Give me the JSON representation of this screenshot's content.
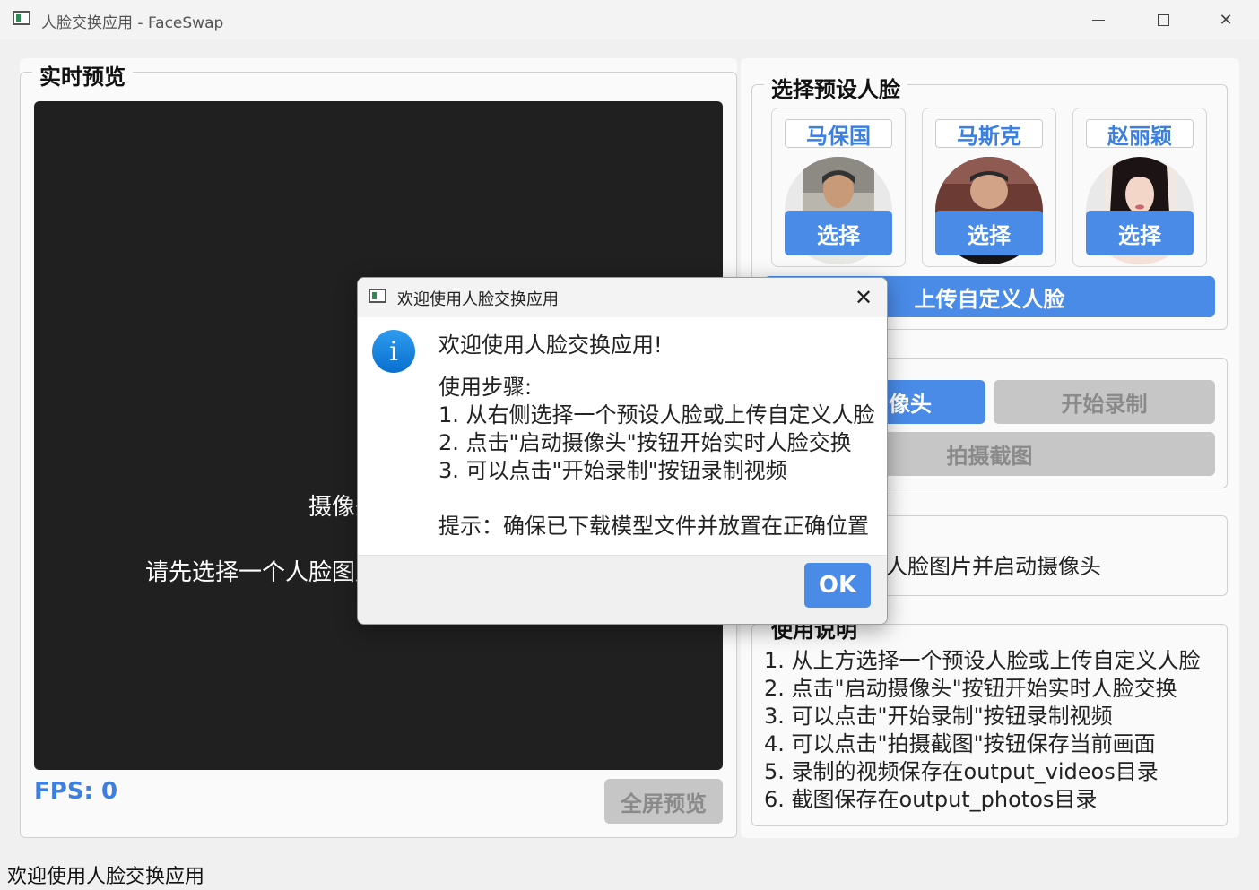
{
  "window": {
    "title": "人脸交换应用 - FaceSwap"
  },
  "left": {
    "group_title": "实时预览",
    "preview_line1": "摄像头未启动",
    "preview_line2": "请先选择一个人脸图片，然后点击启动摄像头",
    "fps": "FPS: 0",
    "fullscreen_label": "全屏预览"
  },
  "faces": {
    "group_title": "选择预设人脸",
    "items": [
      {
        "name": "马保国",
        "select_label": "选择"
      },
      {
        "name": "马斯克",
        "select_label": "选择"
      },
      {
        "name": "赵丽颖",
        "select_label": "选择"
      }
    ],
    "upload_label": "上传自定义人脸"
  },
  "controls": {
    "start_camera_label": "启动摄像头",
    "start_camera_visible": "像头",
    "record_label": "开始录制",
    "snapshot_label": "拍摄截图"
  },
  "status": {
    "visible_text": "人脸图片并启动摄像头"
  },
  "instructions": {
    "title": "使用说明",
    "items": [
      "1. 从上方选择一个预设人脸或上传自定义人脸",
      "2. 点击\"启动摄像头\"按钮开始实时人脸交换",
      "3. 可以点击\"开始录制\"按钮录制视频",
      "4. 可以点击\"拍摄截图\"按钮保存当前画面",
      "5. 录制的视频保存在output_videos目录",
      "6. 截图保存在output_photos目录"
    ]
  },
  "statusbar": {
    "text": "欢迎使用人脸交换应用"
  },
  "dialog": {
    "title": "欢迎使用人脸交换应用",
    "heading": "欢迎使用人脸交换应用!",
    "steps_title": "使用步骤:",
    "steps": [
      "1. 从右侧选择一个预设人脸或上传自定义人脸",
      "2. 点击\"启动摄像头\"按钮开始实时人脸交换",
      "3. 可以点击\"开始录制\"按钮录制视频"
    ],
    "tip": "提示：确保已下载模型文件并放置在正确位置",
    "ok_label": "OK"
  },
  "colors": {
    "accent": "#4a8be8",
    "fps_text": "#3b7fe0",
    "preview_bg": "#202020",
    "disabled_bg": "#c6c6c6"
  }
}
